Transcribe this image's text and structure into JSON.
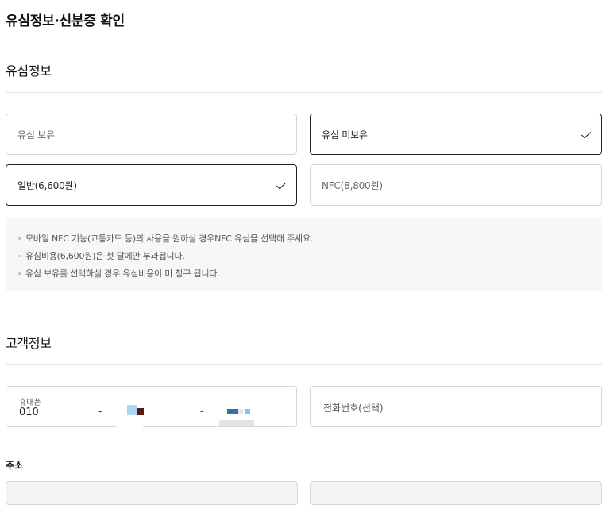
{
  "page": {
    "title": "유심정보·신분증 확인"
  },
  "usim_section": {
    "title": "유심정보",
    "ownership_options": [
      {
        "label": "유심 보유",
        "selected": false
      },
      {
        "label": "유심 미보유",
        "selected": true
      }
    ],
    "type_options": [
      {
        "label": "일반(6,600원)",
        "selected": true
      },
      {
        "label": "NFC(8,800원)",
        "selected": false
      }
    ],
    "notices": [
      "모바일 NFC 기능(교통카드 등)의 사용을 원하실 경우NFC 유심을 선택해 주세요.",
      "유심비용(6,600원)은 첫 달에만 부과됩니다.",
      "유심 보유를 선택하실 경우 유심비용이 미 청구 됩니다."
    ]
  },
  "customer_section": {
    "title": "고객정보",
    "mobile": {
      "label": "휴대폰",
      "prefix": "010",
      "separator": "-"
    },
    "phone": {
      "placeholder": "전화번호(선택)"
    },
    "address": {
      "label": "주소"
    }
  },
  "colors": {
    "selected_border": "#222222",
    "default_border": "#d6d6d6",
    "notice_bg": "#f7f7f7"
  }
}
